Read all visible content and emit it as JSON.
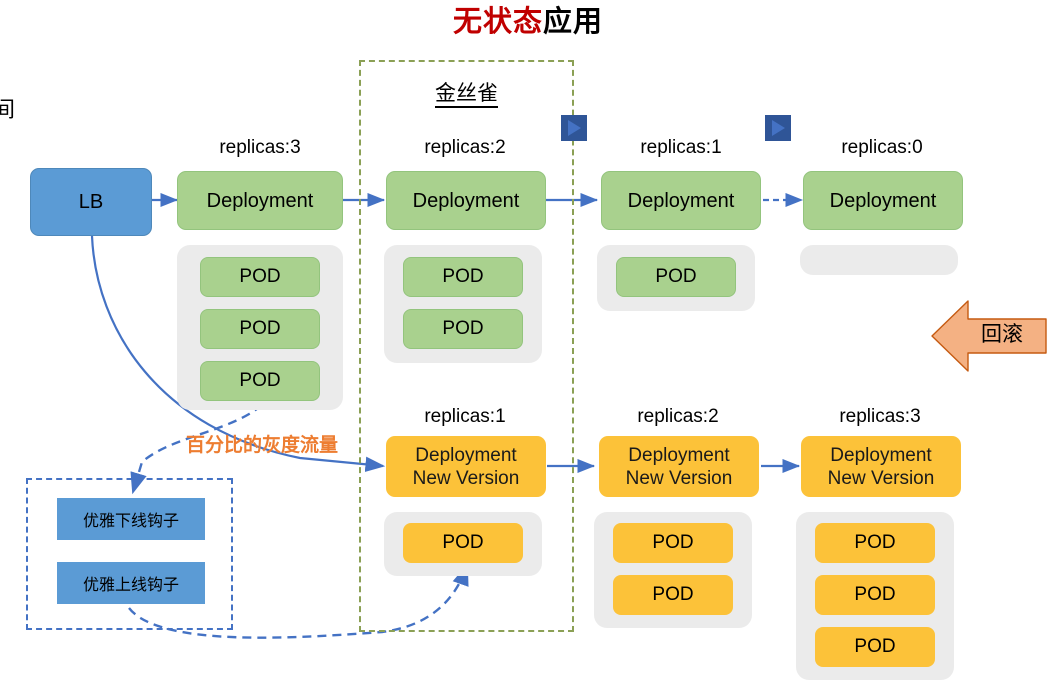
{
  "title": {
    "highlight": "无状态",
    "rest": "应用"
  },
  "left_cut_glyph": "间",
  "canary": {
    "label": "金丝雀"
  },
  "traffic_label": "百分比的灰度流量",
  "rollback": {
    "label": "回滚",
    "color": "#f4b183"
  },
  "colors": {
    "green_fill": "#a9d18e",
    "green_border": "#93c47d",
    "orange_fill": "#fcc239",
    "blue_fill": "#5b9bd5",
    "pod_group_bg": "#ebebeb",
    "canary_border": "#8ba055",
    "hooks_border": "#4472c4",
    "arrow": "#4472c4",
    "title_red": "#c00000",
    "traffic_orange": "#ed7d31",
    "play_marker": "#2f5597"
  },
  "lb": {
    "label": "LB"
  },
  "old_version_row": [
    {
      "replicas": "replicas:3",
      "deployment": "Deployment",
      "pods": [
        "POD",
        "POD",
        "POD"
      ]
    },
    {
      "replicas": "replicas:2",
      "deployment": "Deployment",
      "pods": [
        "POD",
        "POD"
      ]
    },
    {
      "replicas": "replicas:1",
      "deployment": "Deployment",
      "pods": [
        "POD"
      ]
    },
    {
      "replicas": "replicas:0",
      "deployment": "Deployment",
      "pods": []
    }
  ],
  "new_version_row": [
    {
      "replicas": "replicas:1",
      "deployment_line1": "Deployment",
      "deployment_line2": "New Version",
      "pods": [
        "POD"
      ]
    },
    {
      "replicas": "replicas:2",
      "deployment_line1": "Deployment",
      "deployment_line2": "New Version",
      "pods": [
        "POD",
        "POD"
      ]
    },
    {
      "replicas": "replicas:3",
      "deployment_line1": "Deployment",
      "deployment_line2": "New Version",
      "pods": [
        "POD",
        "POD",
        "POD"
      ]
    }
  ],
  "hooks": [
    {
      "label": "优雅下线钩子"
    },
    {
      "label": "优雅上线钩子"
    }
  ]
}
